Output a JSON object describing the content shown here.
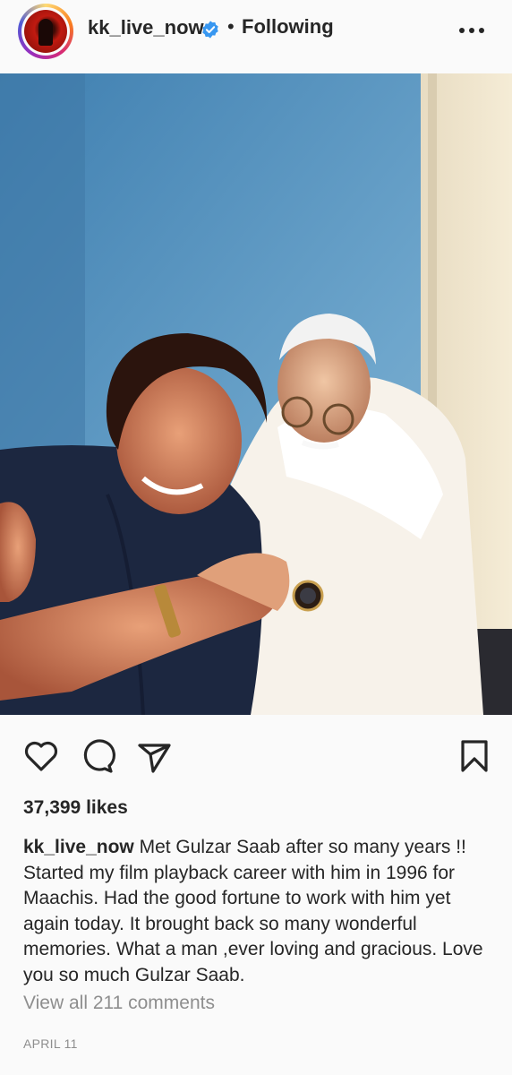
{
  "post": {
    "username": "kk_live_now",
    "follow_status": "Following",
    "separator": "•",
    "likes": "37,399 likes",
    "caption_user": "kk_live_now",
    "caption_text": "Met Gulzar Saab after so many years !! Started my film playback career with him in 1996 for Maachis. Had the good fortune to work with him yet again today. It brought back so many wonderful memories. What a man ,ever loving and gracious. Love you so much Gulzar Saab.",
    "view_comments": "View all 211 comments",
    "date": "APRIL 11"
  },
  "icons": {
    "verified": "verified-badge-icon",
    "more": "more-options-icon",
    "like": "heart-icon",
    "comment": "comment-icon",
    "share": "send-icon",
    "save": "bookmark-icon"
  },
  "colors": {
    "verified_blue": "#3897f0",
    "text": "#262626",
    "secondary_text": "#8e8e8e",
    "background": "#fafafa"
  }
}
